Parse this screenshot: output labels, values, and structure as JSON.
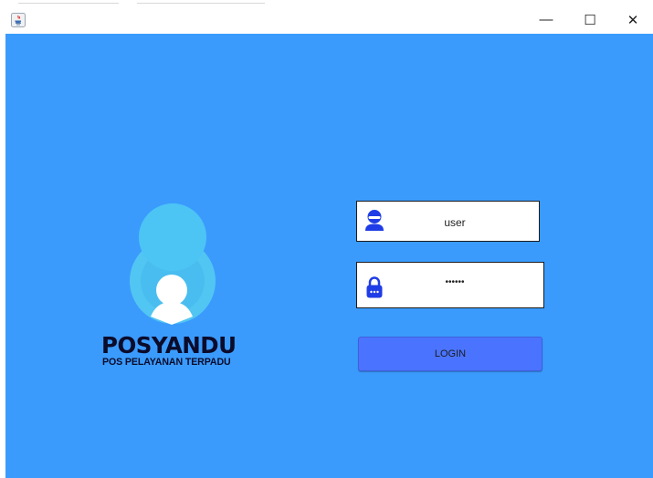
{
  "window": {
    "controls": {
      "minimize_glyph": "—",
      "maximize_glyph": "☐",
      "close_glyph": "✕"
    },
    "app_icon": "java-app-icon"
  },
  "brand": {
    "title": "POSYANDU",
    "subtitle": "POS PELAYANAN TERPADU",
    "logo_icon": "posyandu-logo-person-icon"
  },
  "login_form": {
    "username": {
      "value": "user",
      "icon": "user-icon"
    },
    "password": {
      "value": "******",
      "icon": "lock-icon"
    },
    "login_label": "LOGIN"
  },
  "colors": {
    "background": "#3a9bfd",
    "button": "#4a74ff",
    "icon_blue": "#1f3de6",
    "brand_text": "#0b0b2a"
  }
}
